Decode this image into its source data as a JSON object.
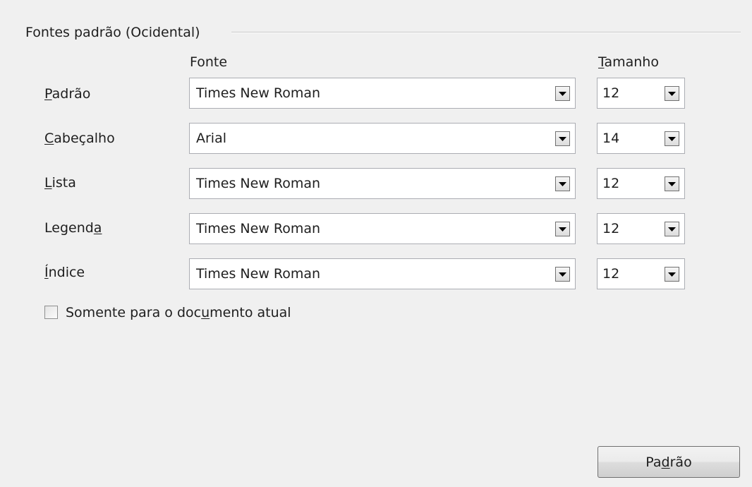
{
  "group": {
    "title": "Fontes padrão (Ocidental)"
  },
  "columns": {
    "font_header": "Fonte",
    "size_header": "Tamanho"
  },
  "rows": [
    {
      "label": "Padrão",
      "font": "Times New Roman",
      "size": "12"
    },
    {
      "label": "Cabeçalho",
      "font": "Arial",
      "size": "14"
    },
    {
      "label": "Lista",
      "font": "Times New Roman",
      "size": "12"
    },
    {
      "label": "Legenda",
      "font": "Times New Roman",
      "size": "12"
    },
    {
      "label": "Índice",
      "font": "Times New Roman",
      "size": "12"
    }
  ],
  "checkbox": {
    "label": "Somente para o documento atual",
    "checked": false
  },
  "buttons": {
    "default_label": "Padrão"
  },
  "icons": {
    "dropdown": "chevron-down-icon"
  }
}
